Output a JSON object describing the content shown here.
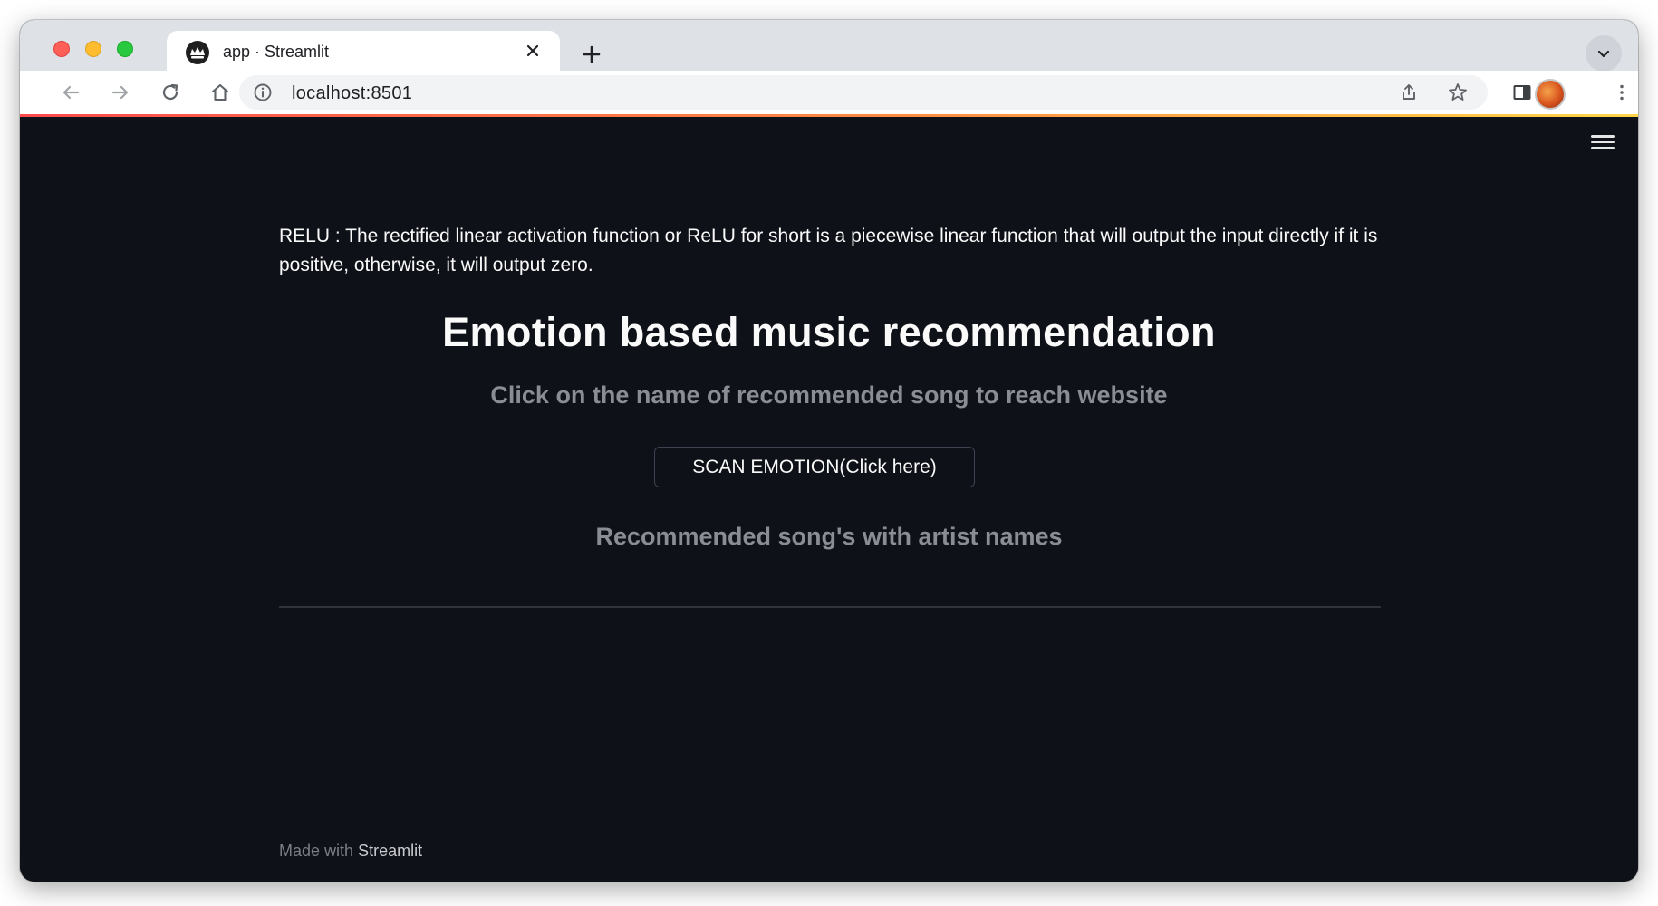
{
  "browser": {
    "tab": {
      "title": "app · Streamlit",
      "favicon": "streamlit-crown-icon"
    },
    "toolbar": {
      "url": "localhost:8501",
      "icons": [
        "back-arrow-icon",
        "forward-arrow-icon",
        "reload-icon",
        "home-icon",
        "info-icon",
        "share-icon",
        "star-icon",
        "side-panel-icon",
        "profile-avatar",
        "more-vert-icon"
      ]
    },
    "colors": {
      "tabstrip": "#dee1e6",
      "close": "#ff5f57",
      "minimize": "#febc2e",
      "maximize": "#28c840"
    }
  },
  "app": {
    "relu_text": "RELU : The rectified linear activation function or ReLU for short is a piecewise linear function that will output the input directly if it is positive, otherwise, it will output zero.",
    "title": "Emotion based music recommendation",
    "subtitle": "Click on the name of recommended song to reach website",
    "scan_button": "SCAN EMOTION(Click here)",
    "recommendations_heading": "Recommended song's with artist names",
    "footer_prefix": "Made with",
    "footer_brand": "Streamlit",
    "colors": {
      "background": "#0e1117",
      "text": "#fafafa",
      "muted": "#8a8d93"
    }
  }
}
